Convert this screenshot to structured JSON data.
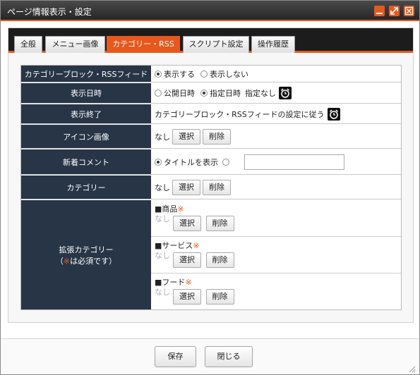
{
  "window": {
    "title": "ページ情報表示・設定"
  },
  "tabs": [
    {
      "label": "全般"
    },
    {
      "label": "メニュー画像"
    },
    {
      "label": "カテゴリー・RSS"
    },
    {
      "label": "スクリプト設定"
    },
    {
      "label": "操作履歴"
    }
  ],
  "active_tab": "カテゴリー・RSS",
  "rows": {
    "category_block": {
      "label": "カテゴリーブロック・RSSフィード",
      "option_show": "表示する",
      "option_hide": "表示しない",
      "selected": "表示する"
    },
    "start_date": {
      "label": "表示日時",
      "option_public": "公開日時",
      "option_specified": "指定日時",
      "value": "指定なし",
      "selected": "指定日時"
    },
    "end_date": {
      "label": "表示終了",
      "value": "カテゴリーブロック・RSSフィードの設定に従う"
    },
    "icon_image": {
      "label": "アイコン画像",
      "value": "なし",
      "select_label": "選択",
      "delete_label": "削除"
    },
    "new_comment": {
      "label": "新着コメント",
      "option_title": "タイトルを表示",
      "input_value": "",
      "selected": "タイトルを表示"
    },
    "category": {
      "label": "カテゴリー",
      "value": "なし",
      "select_label": "選択",
      "delete_label": "削除"
    },
    "extended_category": {
      "label_line1": "拡張カテゴリー",
      "label_paren_open": "（",
      "label_mark": "※",
      "label_rest": "は必須です）",
      "items": [
        {
          "name": "■商品",
          "mark": "※",
          "value": "なし",
          "select_label": "選択",
          "delete_label": "削除"
        },
        {
          "name": "■サービス",
          "mark": "※",
          "value": "なし",
          "select_label": "選択",
          "delete_label": "削除"
        },
        {
          "name": "■フード",
          "mark": "※",
          "value": "なし",
          "select_label": "選択",
          "delete_label": "削除"
        }
      ]
    }
  },
  "footer": {
    "save_label": "保存",
    "close_label": "閉じる"
  },
  "colors": {
    "accent": "#e8581c",
    "label_bg": "#283546",
    "titlebar": "#2d2d2d",
    "tabbar": "#1c1c1c"
  },
  "icons": {
    "minimize": "minimize-icon",
    "expand": "expand-icon",
    "close": "close-icon",
    "alarm": "alarm-clock-icon"
  }
}
